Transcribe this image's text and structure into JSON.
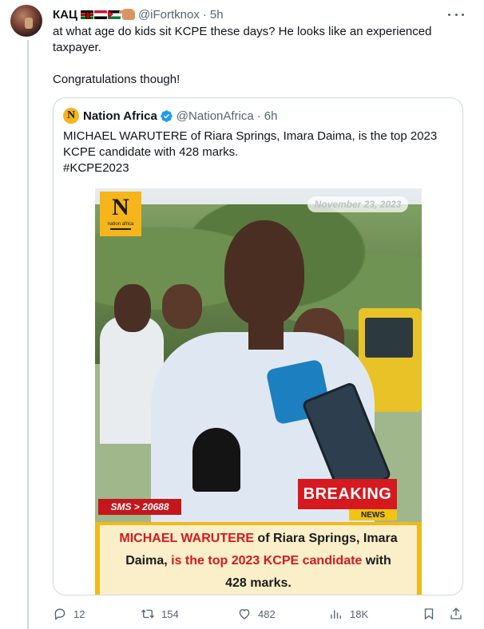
{
  "author": {
    "display_name": "КАЦ",
    "handle": "@iFortknox",
    "time": "5h",
    "flags": [
      "kenya-flag",
      "egypt-flag",
      "palestine-flag"
    ],
    "emoji": "pinching-hand-emoji"
  },
  "tweet": {
    "line1": "at what age do kids sit KCPE these days? He looks like an experienced taxpayer.",
    "line2": "Congratulations though!"
  },
  "quote": {
    "display_name": "Nation Africa",
    "handle": "@NationAfrica",
    "time": "6h",
    "avatar_letter": "N",
    "text_lines": [
      "MICHAEL WARUTERE of Riara Springs, Imara Daima, is the top 2023",
      "KCPE candidate with 428 marks.",
      "#KCPE2023"
    ],
    "media": {
      "logo_letter": "N",
      "logo_caption": "nation africa",
      "date": "November 23, 2023",
      "sms": "SMS > 20688",
      "breaking": "BREAKING",
      "news": "NEWS",
      "banner": {
        "l1_red": "MICHAEL WARUTERE",
        "l1_rest": " of Riara Springs, Imara",
        "l2_a": "Daima, ",
        "l2_red": "is the top 2023 KCPE candidate",
        "l2_b": " with",
        "l3": "428 marks."
      }
    }
  },
  "actions": {
    "replies": "12",
    "retweets": "154",
    "likes": "482",
    "views": "18K"
  },
  "colors": {
    "text": "#0f1419",
    "secondary": "#536471",
    "verified": "#1d9bf0",
    "border": "#cfd9de",
    "brand_yellow": "#f5b51b",
    "breaking_red": "#d5191f"
  }
}
